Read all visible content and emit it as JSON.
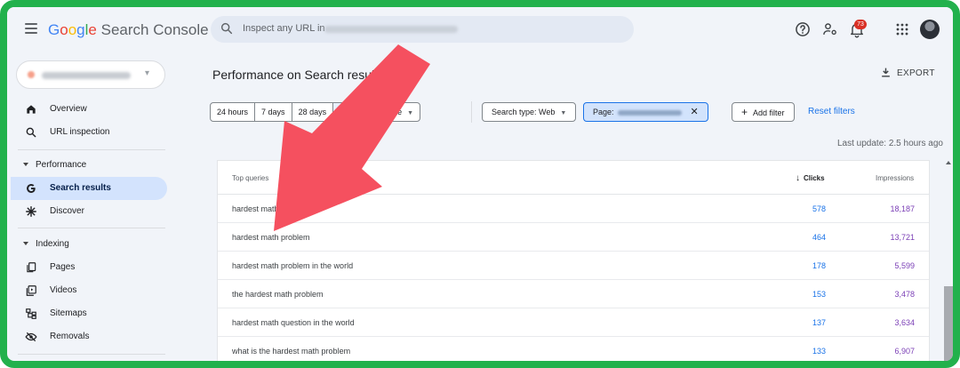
{
  "app": {
    "logo_google": [
      "G",
      "o",
      "o",
      "g",
      "l",
      "e"
    ],
    "logo_product": "Search Console"
  },
  "search": {
    "placeholder": "Inspect any URL in"
  },
  "header": {
    "notifications_count": "73"
  },
  "sidebar": {
    "items": [
      {
        "label": "Overview",
        "icon": "home-icon"
      },
      {
        "label": "URL inspection",
        "icon": "search-icon"
      }
    ],
    "section_performance": "Performance",
    "performance_items": [
      {
        "label": "Search results",
        "icon": "google-g-icon",
        "active": true
      },
      {
        "label": "Discover",
        "icon": "asterisk-icon"
      }
    ],
    "section_indexing": "Indexing",
    "indexing_items": [
      {
        "label": "Pages",
        "icon": "pages-icon"
      },
      {
        "label": "Videos",
        "icon": "video-icon"
      },
      {
        "label": "Sitemaps",
        "icon": "sitemap-icon"
      },
      {
        "label": "Removals",
        "icon": "removals-icon"
      }
    ]
  },
  "main": {
    "title": "Performance on Search results",
    "export_label": "EXPORT",
    "date_ranges": [
      "24 hours",
      "7 days",
      "28 days",
      "3",
      "More"
    ],
    "search_type": "Search type: Web",
    "page_filter_label": "Page:",
    "add_filter": "Add filter",
    "reset_filters": "Reset filters",
    "last_update": "Last update: 2.5 hours ago"
  },
  "table": {
    "columns": [
      "Top queries",
      "Clicks",
      "Impressions"
    ],
    "rows": [
      {
        "query": "hardest math question",
        "clicks": "578",
        "impressions": "18,187"
      },
      {
        "query": "hardest math problem",
        "clicks": "464",
        "impressions": "13,721"
      },
      {
        "query": "hardest math problem in the world",
        "clicks": "178",
        "impressions": "5,599"
      },
      {
        "query": "the hardest math problem",
        "clicks": "153",
        "impressions": "3,478"
      },
      {
        "query": "hardest math question in the world",
        "clicks": "137",
        "impressions": "3,634"
      },
      {
        "query": "what is the hardest math problem",
        "clicks": "133",
        "impressions": "6,907"
      }
    ]
  },
  "colors": {
    "frame_border": "#22b14c",
    "annotation_arrow": "#f5505f",
    "clicks": "#1a73e8",
    "impressions": "#7b3fb6",
    "active_nav": "#d3e3fd"
  }
}
